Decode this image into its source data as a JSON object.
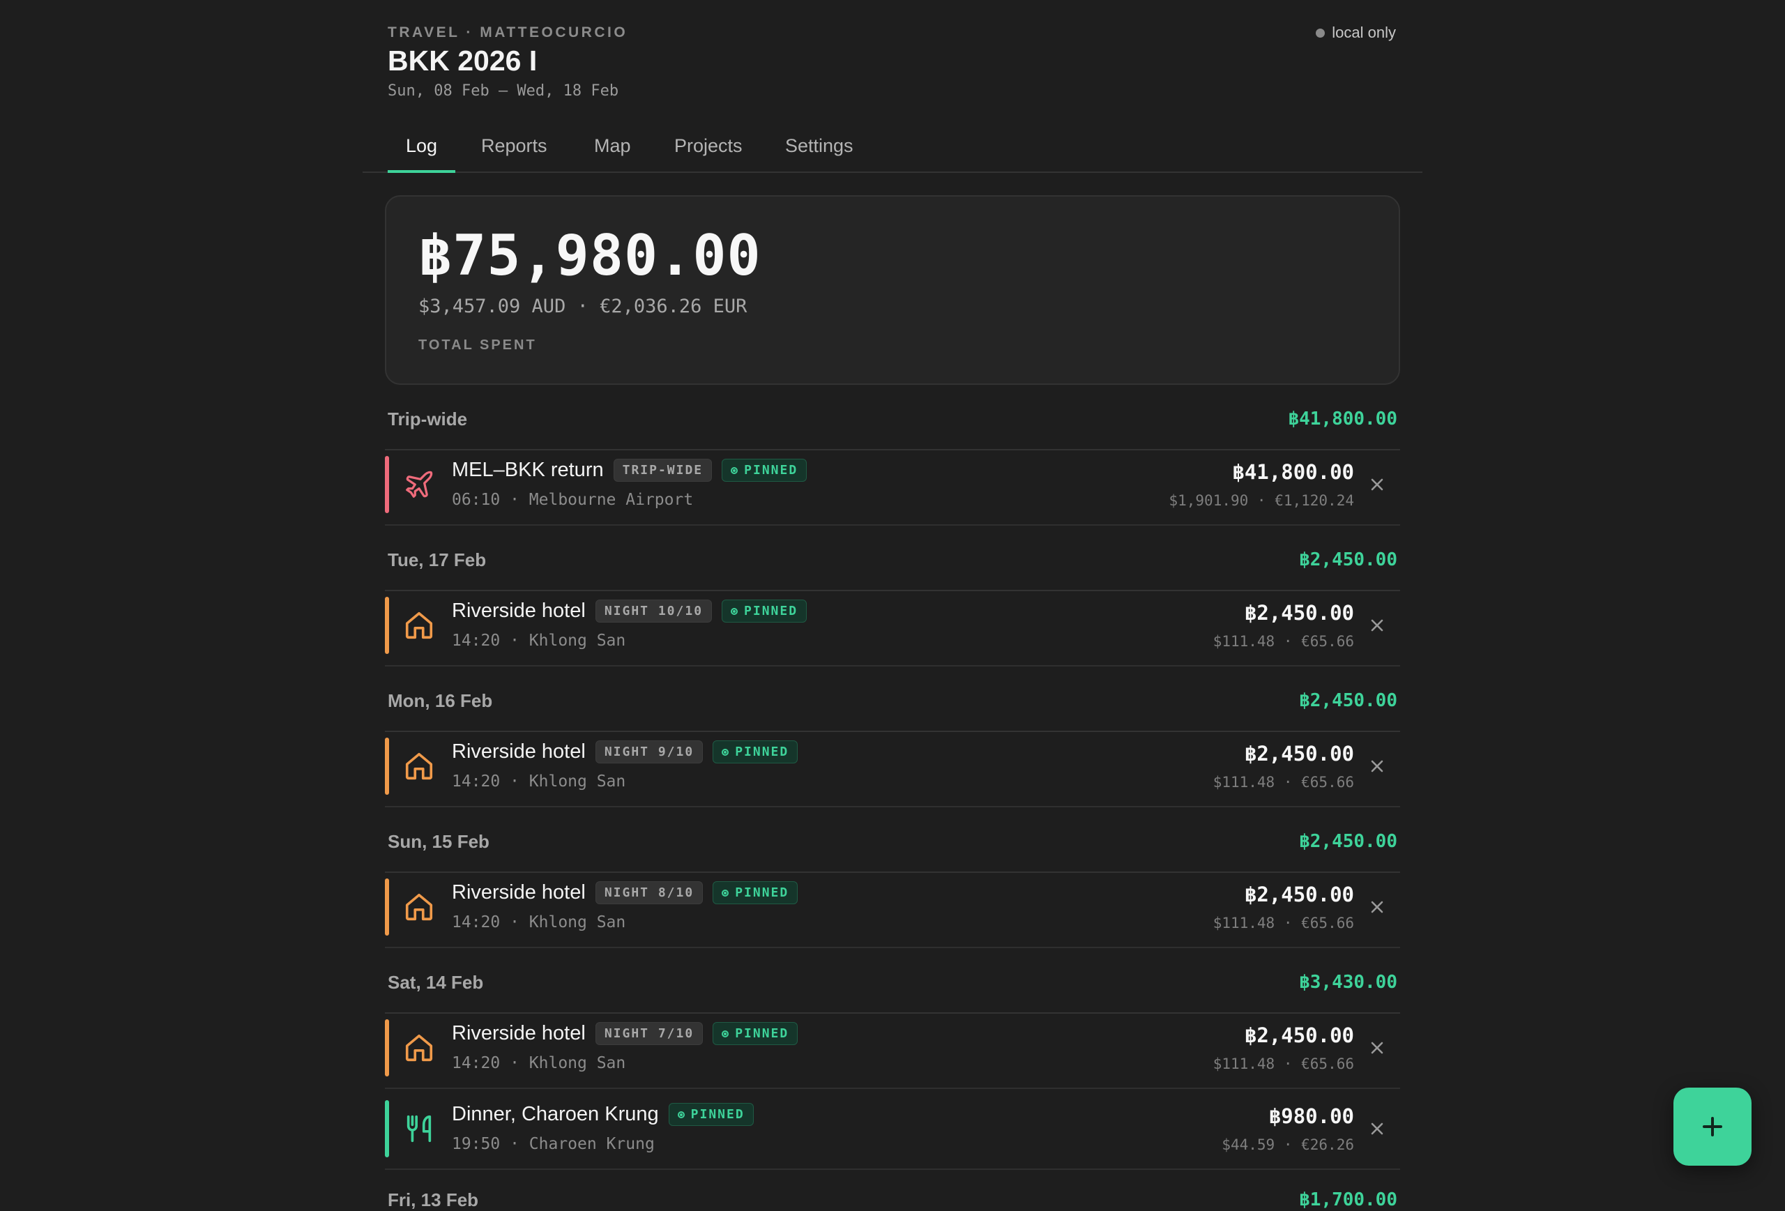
{
  "header": {
    "eyebrow": "TRAVEL · MATTEOCURCIO",
    "title": "BKK 2026 I",
    "date_range": "Sun, 08 Feb – Wed, 18 Feb",
    "sync_status": "local only"
  },
  "tabs": [
    {
      "label": "Log",
      "active": true
    },
    {
      "label": "Reports",
      "active": false
    },
    {
      "label": "Map",
      "active": false
    },
    {
      "label": "Projects",
      "active": false
    },
    {
      "label": "Settings",
      "active": false
    }
  ],
  "summary": {
    "total": "฿75,980.00",
    "conversions": "$3,457.09 AUD · €2,036.26 EUR",
    "label": "TOTAL SPENT"
  },
  "groups": [
    {
      "name": "Trip-wide",
      "total": "฿41,800.00",
      "entries": [
        {
          "icon": "plane-icon",
          "name": "MEL–BKK return",
          "tag": "TRIP-WIDE",
          "pinned": "PINNED",
          "meta": "06:10 · Melbourne Airport",
          "amount": "฿41,800.00",
          "conversion": "$1,901.90 · €1,120.24"
        }
      ]
    },
    {
      "name": "Tue, 17 Feb",
      "total": "฿2,450.00",
      "entries": [
        {
          "icon": "house-icon",
          "name": "Riverside hotel",
          "tag": "NIGHT 10/10",
          "pinned": "PINNED",
          "meta": "14:20 · Khlong San",
          "amount": "฿2,450.00",
          "conversion": "$111.48 · €65.66"
        }
      ]
    },
    {
      "name": "Mon, 16 Feb",
      "total": "฿2,450.00",
      "entries": [
        {
          "icon": "house-icon",
          "name": "Riverside hotel",
          "tag": "NIGHT 9/10",
          "pinned": "PINNED",
          "meta": "14:20 · Khlong San",
          "amount": "฿2,450.00",
          "conversion": "$111.48 · €65.66"
        }
      ]
    },
    {
      "name": "Sun, 15 Feb",
      "total": "฿2,450.00",
      "entries": [
        {
          "icon": "house-icon",
          "name": "Riverside hotel",
          "tag": "NIGHT 8/10",
          "pinned": "PINNED",
          "meta": "14:20 · Khlong San",
          "amount": "฿2,450.00",
          "conversion": "$111.48 · €65.66"
        }
      ]
    },
    {
      "name": "Sat, 14 Feb",
      "total": "฿3,430.00",
      "entries": [
        {
          "icon": "house-icon",
          "name": "Riverside hotel",
          "tag": "NIGHT 7/10",
          "pinned": "PINNED",
          "meta": "14:20 · Khlong San",
          "amount": "฿2,450.00",
          "conversion": "$111.48 · €65.66"
        },
        {
          "icon": "fork-knife-icon",
          "name": "Dinner, Charoen Krung",
          "pinned": "PINNED",
          "meta": "19:50 · Charoen Krung",
          "amount": "฿980.00",
          "conversion": "$44.59 · €26.26"
        }
      ]
    }
  ],
  "next_group_partial": {
    "name": "Fri, 13 Feb",
    "total": "฿1,700.00"
  },
  "icons": {
    "delete": "close-icon",
    "fab": "plus-icon"
  },
  "colors": {
    "accent": "#3ed39a",
    "transport": "#ef6b7b",
    "lodging": "#f09a4a",
    "food": "#3ed39a",
    "background": "#1e1e1e"
  }
}
